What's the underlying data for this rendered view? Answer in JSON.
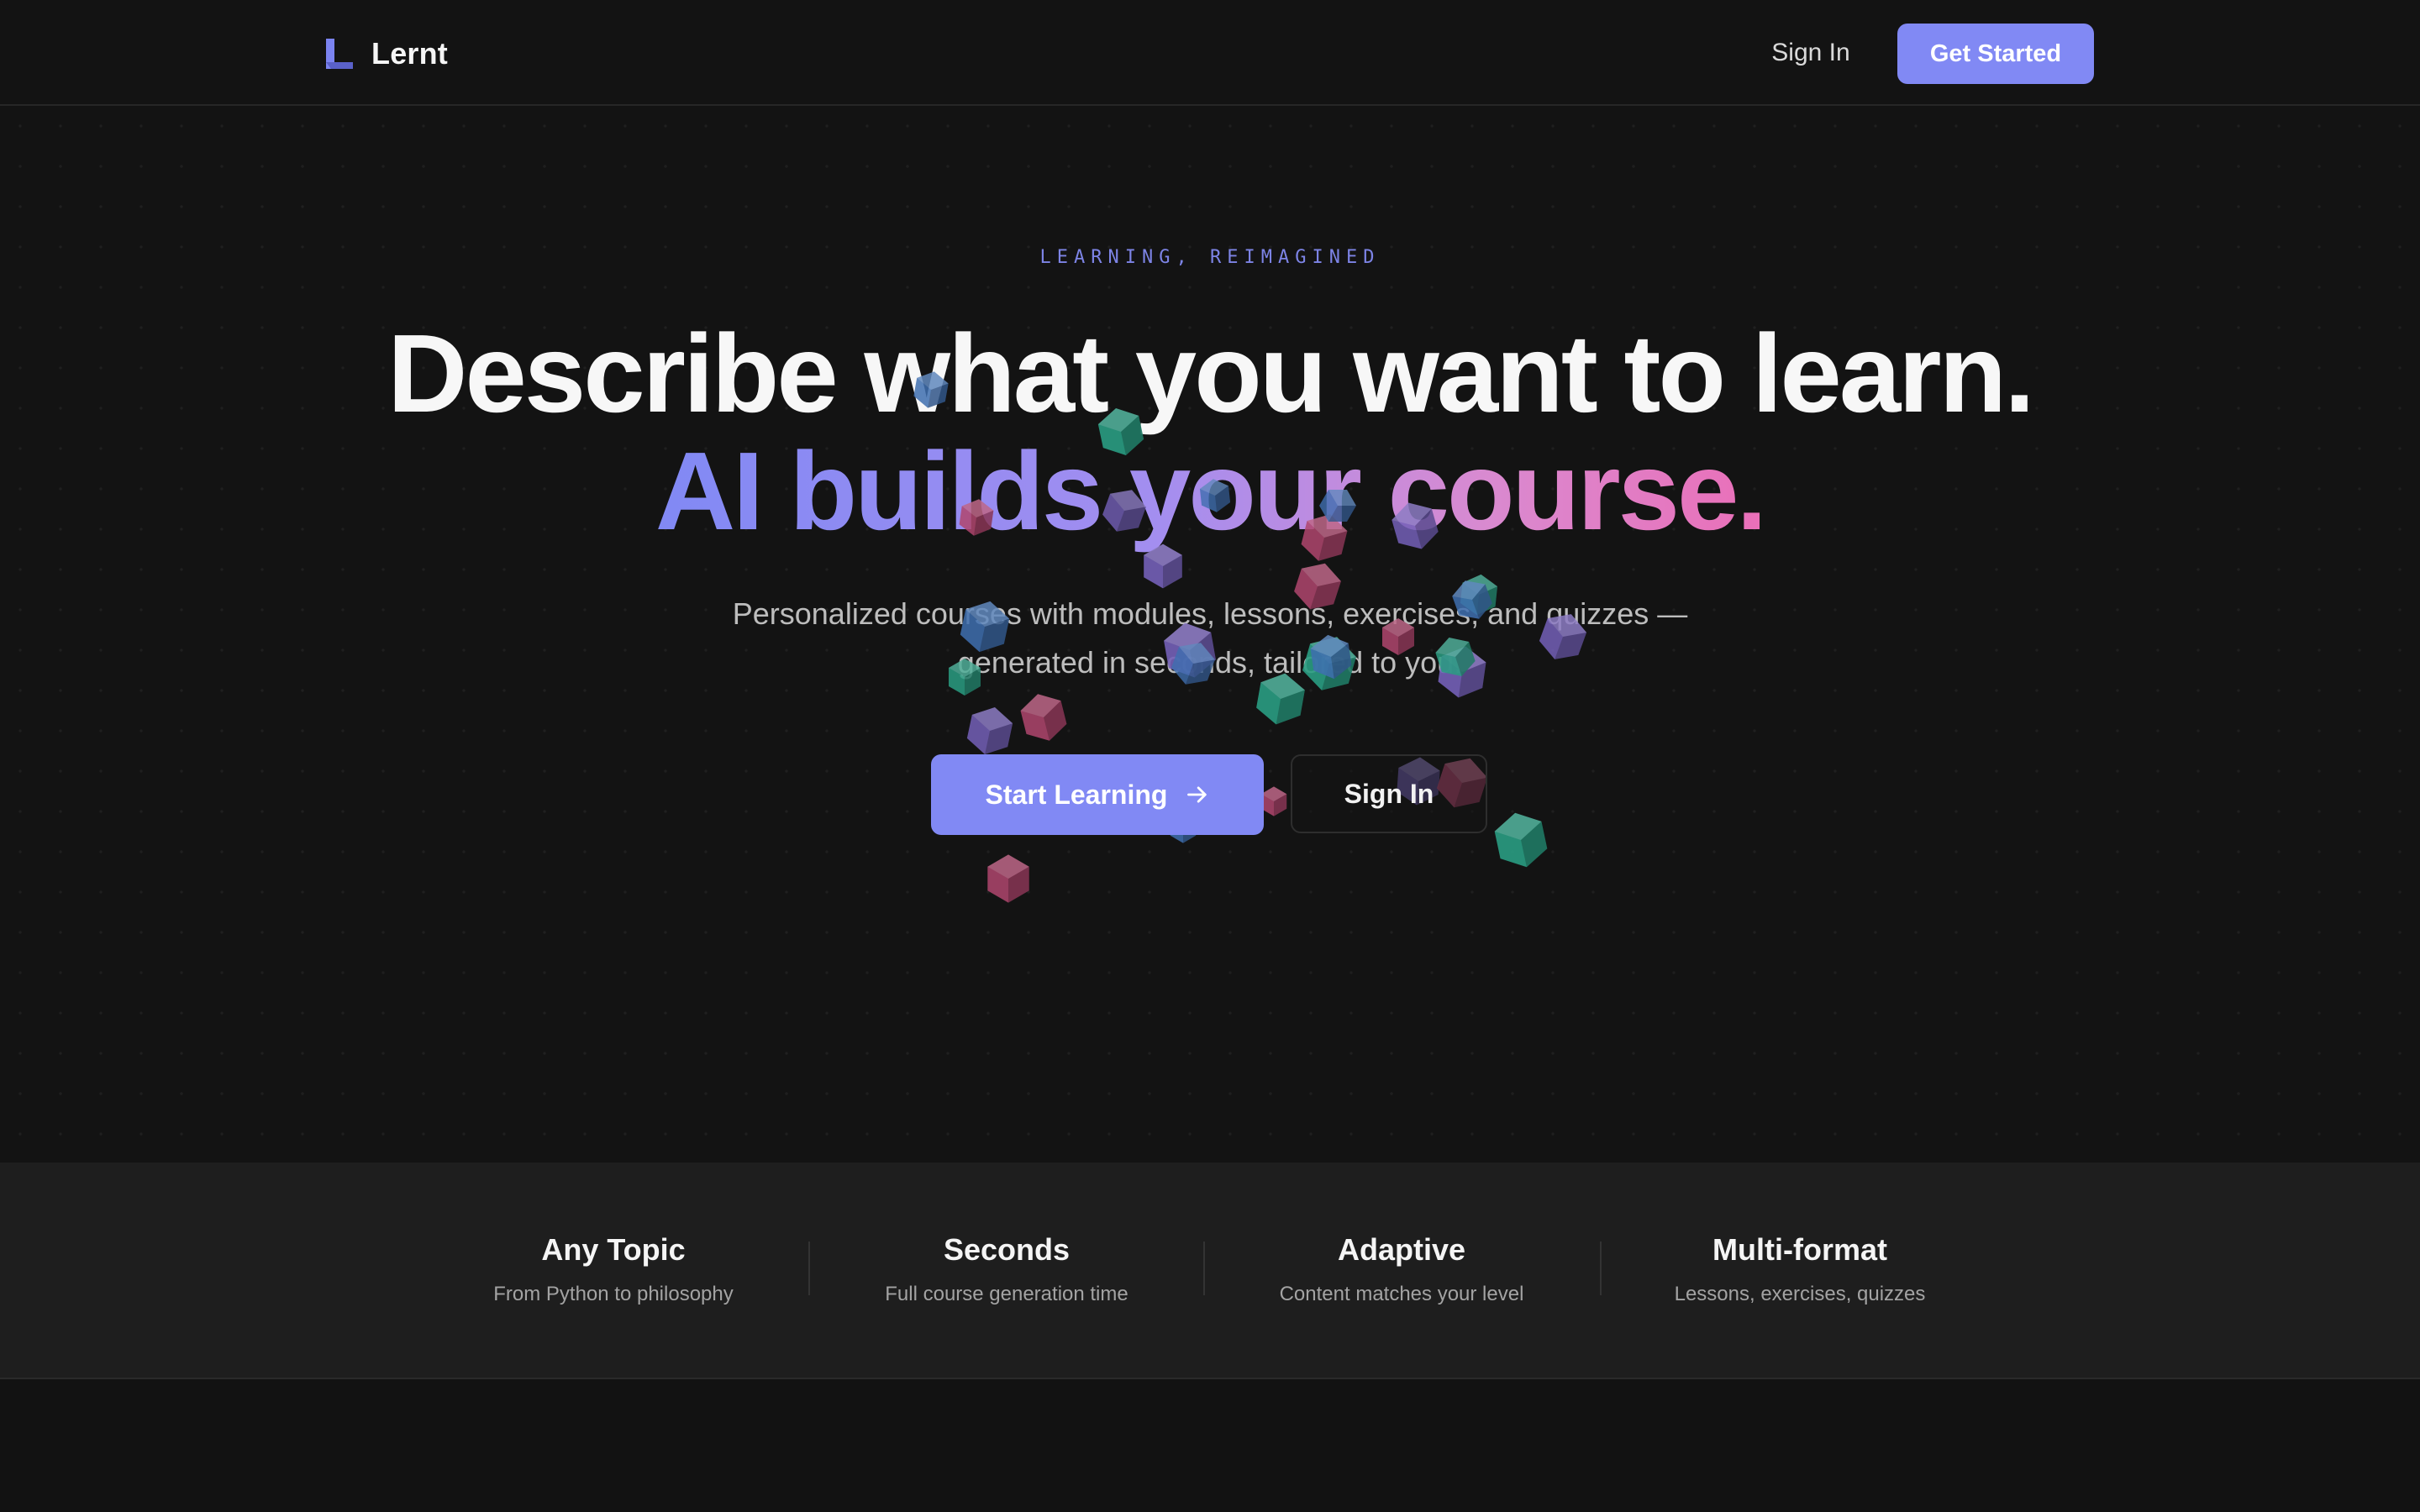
{
  "nav": {
    "brand": "Lernt",
    "sign_in": "Sign In",
    "get_started": "Get Started",
    "logo_icon": "lernt-logo-icon"
  },
  "hero": {
    "eyebrow": "LEARNING, REIMAGINED",
    "headline_line1": "Describe what you want to learn.",
    "headline_line2": "AI builds your course.",
    "subtitle_line1": "Personalized courses with modules, lessons, exercises, and quizzes —",
    "subtitle_line2": "generated in seconds, tailored to you.",
    "primary_cta": "Start Learning",
    "primary_cta_icon": "arrow-right-icon",
    "secondary_cta": "Sign In",
    "decoration": "floating-cubes"
  },
  "stats": [
    {
      "title": "Any Topic",
      "desc": "From Python to philosophy"
    },
    {
      "title": "Seconds",
      "desc": "Full course generation time"
    },
    {
      "title": "Adaptive",
      "desc": "Content matches your level"
    },
    {
      "title": "Multi-format",
      "desc": "Lessons, exercises, quizzes"
    }
  ],
  "colors": {
    "background": "#131313",
    "accent": "#8189f4",
    "gradient_end": "#ea6fb8",
    "stats_band": "#1e1e1e",
    "cube_teal": "#2a9d82",
    "cube_blue": "#3f6fb0",
    "cube_purple": "#7460b8",
    "cube_pink": "#b0466e"
  }
}
